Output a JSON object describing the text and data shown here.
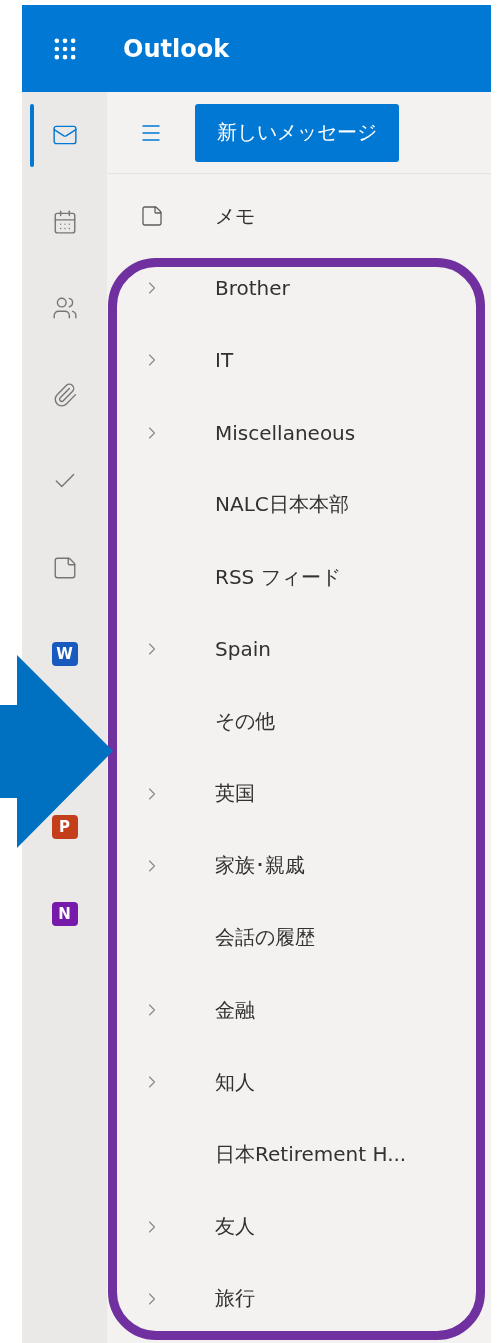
{
  "header": {
    "title": "Outlook"
  },
  "rail": [
    {
      "kind": "mail",
      "selected": true
    },
    {
      "kind": "calendar",
      "selected": false
    },
    {
      "kind": "people",
      "selected": false
    },
    {
      "kind": "files",
      "selected": false
    },
    {
      "kind": "todo",
      "selected": false
    },
    {
      "kind": "notes",
      "selected": false
    },
    {
      "kind": "app",
      "letter": "W",
      "color": "#185abd"
    },
    {
      "kind": "app",
      "letter": "P",
      "color": "#c43e1c"
    },
    {
      "kind": "app",
      "letter": "N",
      "color": "#7719aa"
    }
  ],
  "new_message_button": "新しいメッセージ",
  "notes_folder": "メモ",
  "folders": [
    {
      "label": "Brother",
      "expandable": true
    },
    {
      "label": "IT",
      "expandable": true
    },
    {
      "label": "Miscellaneous",
      "expandable": true
    },
    {
      "label": "NALC日本本部",
      "expandable": false
    },
    {
      "label": "RSS フィード",
      "expandable": false
    },
    {
      "label": "Spain",
      "expandable": true
    },
    {
      "label": "その他",
      "expandable": false
    },
    {
      "label": "英国",
      "expandable": true
    },
    {
      "label": "家族･親戚",
      "expandable": true
    },
    {
      "label": "会話の履歴",
      "expandable": false
    },
    {
      "label": "金融",
      "expandable": true
    },
    {
      "label": "知人",
      "expandable": true
    },
    {
      "label": "日本Retirement H...",
      "expandable": false
    },
    {
      "label": "友人",
      "expandable": true
    },
    {
      "label": "旅行",
      "expandable": true
    }
  ]
}
